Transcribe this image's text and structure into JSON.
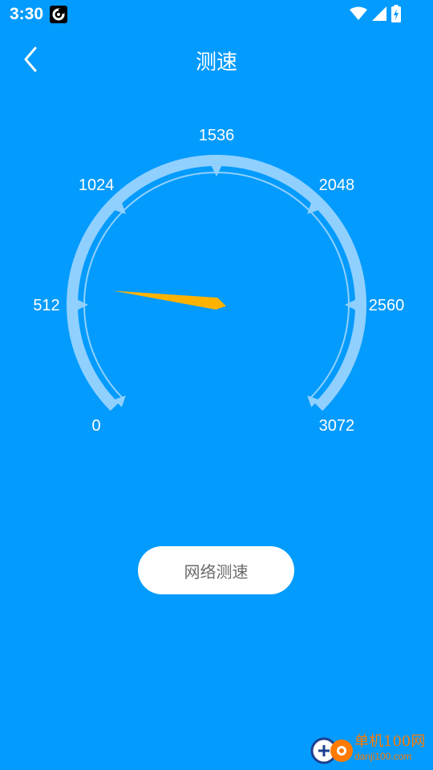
{
  "status_bar": {
    "time": "3:30"
  },
  "app_bar": {
    "title": "测速"
  },
  "gauge": {
    "labels": [
      "0",
      "512",
      "1024",
      "1536",
      "2048",
      "2560",
      "3072"
    ],
    "needle_value": 600,
    "max_value": 3072,
    "colors": {
      "arc": "#90D0FF",
      "needle": "#FFB300"
    }
  },
  "action": {
    "button_label": "网络测速"
  },
  "watermark": {
    "title": "单机100网",
    "url": "danji100.com"
  }
}
